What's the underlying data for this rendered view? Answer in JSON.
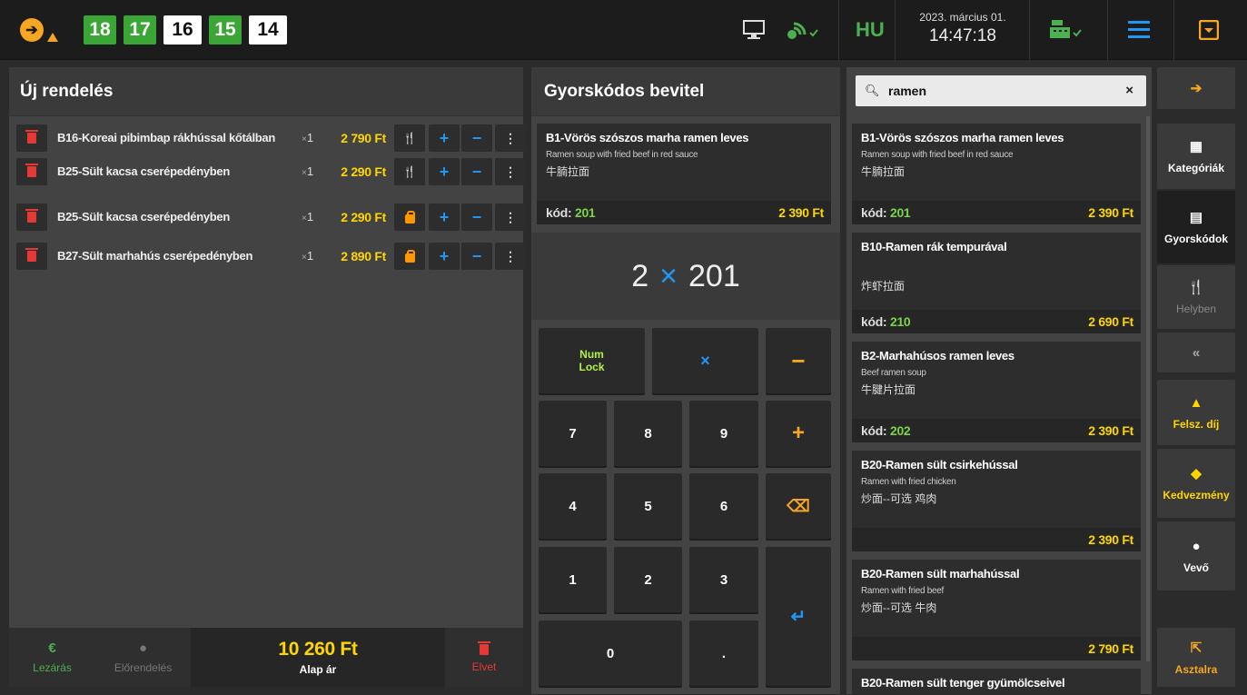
{
  "topbar": {
    "tables": [
      {
        "n": "18",
        "c": "g"
      },
      {
        "n": "17",
        "c": "g"
      },
      {
        "n": "16",
        "c": "w"
      },
      {
        "n": "15",
        "c": "g"
      },
      {
        "n": "14",
        "c": "w"
      }
    ],
    "lang": "HU",
    "date": "2023. március 01.",
    "time": "14:47:18"
  },
  "order": {
    "title": "Új rendelés",
    "items": [
      {
        "name": "B16-Koreai pibimbap rákhússal kőtálban",
        "qty": "1",
        "price": "2 790 Ft",
        "mode": "eat"
      },
      {
        "name": "B25-Sült kacsa cserépedényben",
        "qty": "1",
        "price": "2 290 Ft",
        "mode": "eat"
      },
      {
        "name": "B25-Sült kacsa cserépedényben",
        "qty": "1",
        "price": "2 290 Ft",
        "mode": "bag"
      },
      {
        "name": "B27-Sült marhahús cserépedényben",
        "qty": "1",
        "price": "2 890 Ft",
        "mode": "bag"
      }
    ],
    "footer": {
      "close": "Lezárás",
      "preorder": "Előrendelés",
      "total": "10 260 Ft",
      "total_label": "Alap ár",
      "discard": "Elvet"
    }
  },
  "quick": {
    "title": "Gyorskódos bevitel",
    "card": {
      "title": "B1-Vörös szószos marha ramen leves",
      "en": "Ramen soup with fried beef in red sauce",
      "cn": "牛腩拉面",
      "code_label": "kód:",
      "code": "201",
      "price": "2 390 Ft"
    },
    "display": {
      "qty": "2",
      "x": "×",
      "code": "201"
    },
    "keys": {
      "numlock": "Num",
      "numlock2": "Lock",
      "mult": "×",
      "minus": "−",
      "plus": "+",
      "back": "⌫",
      "enter": "↵",
      "k7": "7",
      "k8": "8",
      "k9": "9",
      "k4": "4",
      "k5": "5",
      "k6": "6",
      "k1": "1",
      "k2": "2",
      "k3": "3",
      "k0": "0",
      "dot": "."
    }
  },
  "search": {
    "value": "ramen",
    "results": [
      {
        "title": "B1-Vörös szószos marha ramen leves",
        "en": "Ramen soup with fried beef in red sauce",
        "cn": "牛腩拉面",
        "code": "201",
        "price": "2 390 Ft"
      },
      {
        "title": "B10-Ramen rák tempurával",
        "en": "",
        "cn": "炸虾拉面",
        "code": "210",
        "price": "2 690 Ft"
      },
      {
        "title": "B2-Marhahúsos ramen leves",
        "en": "Beef ramen soup",
        "cn": "牛腱片拉面",
        "code": "202",
        "price": "2 390 Ft"
      },
      {
        "title": "B20-Ramen sült csirkehússal",
        "en": "Ramen with fried chicken",
        "cn": "炒面--可选 鸡肉",
        "code": "",
        "price": "2 390 Ft"
      },
      {
        "title": "B20-Ramen sült marhahússal",
        "en": "Ramen with fried beef",
        "cn": "炒面--可选 牛肉",
        "code": "",
        "price": "2 790 Ft"
      },
      {
        "title": "B20-Ramen sült tenger gyümölcseivel",
        "en": "",
        "cn": "",
        "code": "",
        "price": ""
      }
    ],
    "code_label": "kód:"
  },
  "side": {
    "categories": "Kategóriák",
    "quickcodes": "Gyorskódok",
    "eatin": "Helyben",
    "service": "Felsz. díj",
    "discount": "Kedvezmény",
    "customer": "Vevő",
    "totable": "Asztalra"
  }
}
